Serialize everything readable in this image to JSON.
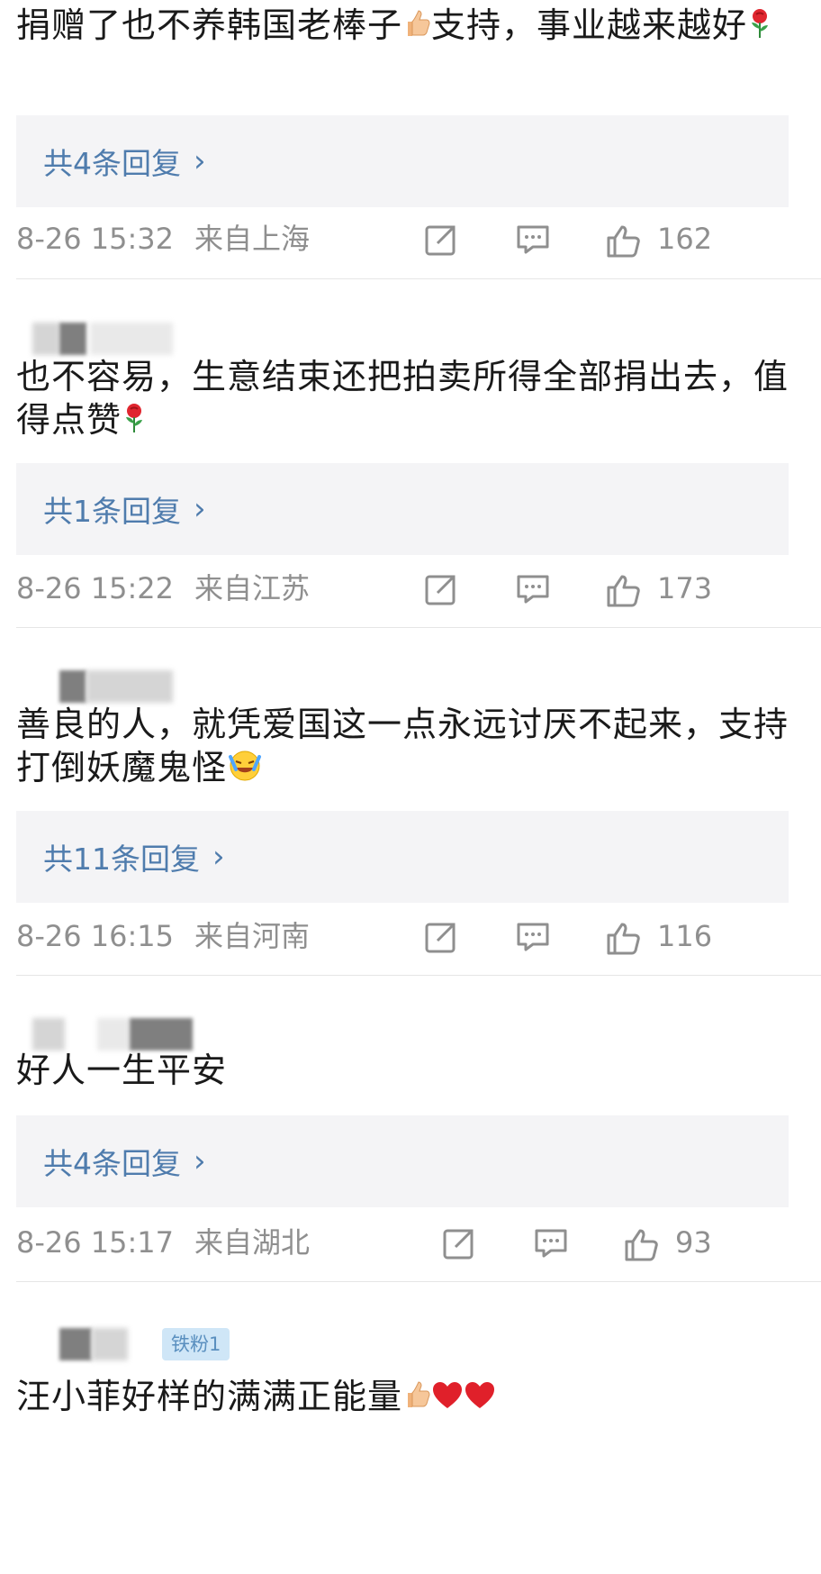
{
  "comments": [
    {
      "text_a": "捐赠了也不养韩国老棒子",
      "emoji_a": "thumbs-up",
      "text_b": "支持，事业越来越好",
      "emoji_b": "rose",
      "reply": "共4条回复",
      "time": "8-26 15:32",
      "location": "来自上海",
      "likes": "162"
    },
    {
      "text_a": "也不容易，生意结束还把拍卖所得全部捐出去，值得点赞",
      "emoji_a": "rose",
      "reply": "共1条回复",
      "time": "8-26 15:22",
      "location": "来自江苏",
      "likes": "173"
    },
    {
      "text_a": "善良的人，就凭爱国这一点永远讨厌不起来，支持打倒妖魔鬼怪",
      "emoji_a": "laugh-cry",
      "reply": "共11条回复",
      "time": "8-26 16:15",
      "location": "来自河南",
      "likes": "116"
    },
    {
      "text_a": "好人一生平安",
      "reply": "共4条回复",
      "time": "8-26 15:17",
      "location": "来自湖北",
      "likes": "93"
    },
    {
      "text_a": "汪小菲好样的满满正能量",
      "emoji_a": "thumbs-up",
      "emoji_b": "red-heart",
      "emoji_c": "red-heart",
      "badge": "铁粉1"
    }
  ],
  "icons": {
    "share": "share-icon",
    "comment": "comment-icon",
    "like": "thumbs-up-icon"
  },
  "colors": {
    "link_blue": "#4f7cad",
    "meta_gray": "#8f8f8f",
    "reply_bg": "#f4f4f6"
  }
}
